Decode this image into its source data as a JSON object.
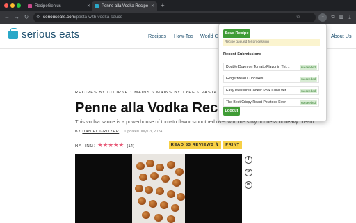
{
  "browser": {
    "tabs": [
      {
        "title": "RecipeGenius",
        "favicon_color": "#c94a8c",
        "active": false
      },
      {
        "title": "Penne alla Vodka Recipe",
        "favicon_color": "#2aa8c8",
        "active": true
      }
    ],
    "new_tab_icon": "plus-icon",
    "address": {
      "host": "seriouseats.com",
      "path": "/pasta-with-vodka-sauce"
    }
  },
  "site": {
    "logo_text": "serious eats",
    "nav": [
      "Recipes",
      "How-Tos",
      "World C",
      "About Us"
    ]
  },
  "article": {
    "breadcrumb": [
      "RECIPES BY COURSE",
      "MAINS",
      "MAINS BY TYPE",
      "PASTA M"
    ],
    "title": "Penne alla Vodka Recip",
    "subhead": "This vodka sauce is a powerhouse of tomato flavor smoothed over with the silky richness of heavy cream.",
    "byline_prefix": "BY",
    "author": "DANIEL GRITZER",
    "updated": "Updated July 03, 2024",
    "rating_label": "RATING:",
    "rating_value": 5,
    "rating_count": "(14)",
    "read_reviews_label": "READ 83 REVIEWS",
    "print_label": "PRINT"
  },
  "popup": {
    "save_label": "Save Recipe",
    "notice": "Recipe queued for processing",
    "recent_label": "Recent Submissions",
    "submissions": [
      {
        "title": "Double Down on Tomato Flavor in Thi…",
        "status": "succeeded"
      },
      {
        "title": "Gingerbread Cupcakes",
        "status": "succeeded"
      },
      {
        "title": "Easy Pressure Cooker Pork Chile Ver…",
        "status": "succeeded"
      },
      {
        "title": "The Best Crispy Roast Potatoes Ever",
        "status": "succeeded"
      }
    ],
    "logout_label": "Logout"
  },
  "colors": {
    "accent_green": "#3f9c35",
    "cta_yellow": "#f7d046",
    "brand_blue": "#1d4f6e",
    "star_pink": "#e85d7a"
  }
}
